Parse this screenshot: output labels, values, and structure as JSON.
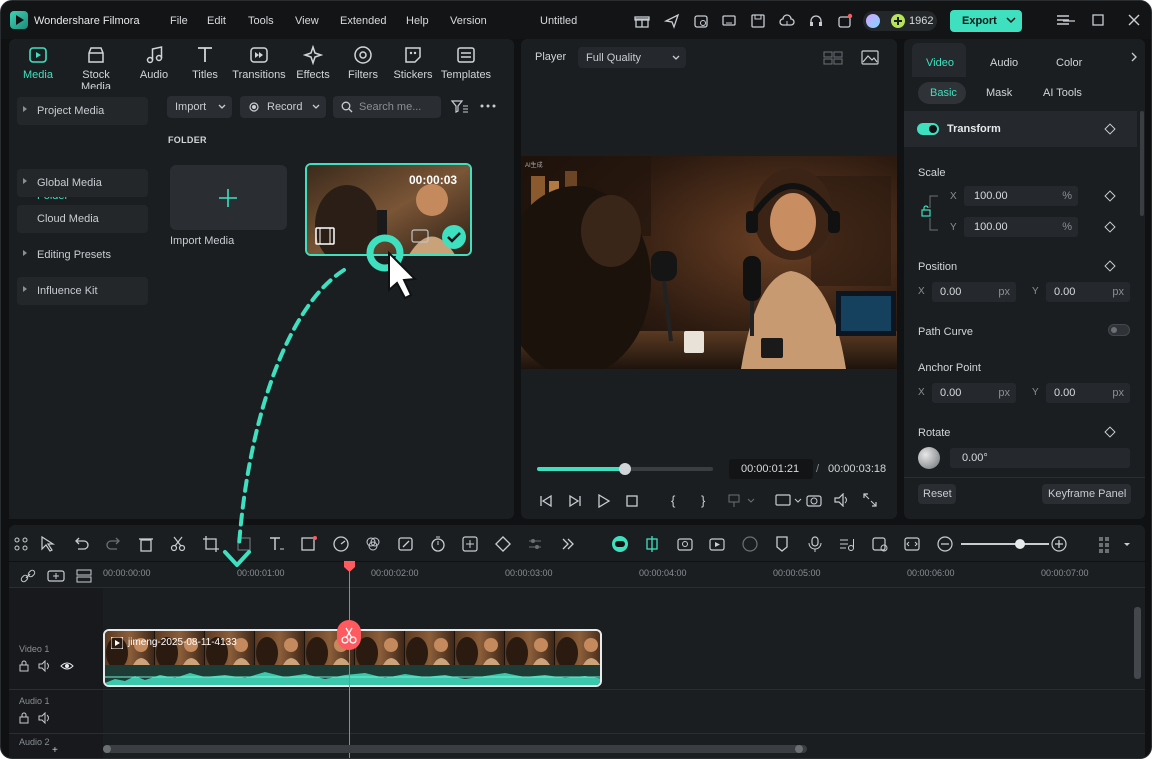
{
  "app": {
    "name": "Wondershare Filmora",
    "doc_title": "Untitled",
    "credits": "1962",
    "export_label": "Export"
  },
  "menu": [
    "File",
    "Edit",
    "Tools",
    "View",
    "Extended",
    "Help",
    "Version"
  ],
  "media_tabs": [
    {
      "label": "Media",
      "icon": "media-icon",
      "active": true
    },
    {
      "label": "Stock Media",
      "icon": "stock-media-icon"
    },
    {
      "label": "Audio",
      "icon": "music-note-icon"
    },
    {
      "label": "Titles",
      "icon": "text-t-icon"
    },
    {
      "label": "Transitions",
      "icon": "transitions-icon"
    },
    {
      "label": "Effects",
      "icon": "sparkle-icon"
    },
    {
      "label": "Filters",
      "icon": "filter-icon"
    },
    {
      "label": "Stickers",
      "icon": "sticker-icon"
    },
    {
      "label": "Templates",
      "icon": "templates-icon"
    }
  ],
  "sidebar": [
    {
      "label": "Project Media",
      "arrow": true,
      "bg": true
    },
    {
      "label": "Folder",
      "active": true
    },
    {
      "label": "Global Media",
      "arrow": true,
      "bg": true
    },
    {
      "label": "Cloud Media",
      "bg": true
    },
    {
      "label": "Editing Presets",
      "arrow": true
    },
    {
      "label": "Influence Kit",
      "arrow": true,
      "bg": true
    }
  ],
  "toolbar": {
    "import_label": "Import",
    "record_label": "Record",
    "search_placeholder": "Search me..."
  },
  "media_area": {
    "section_label": "FOLDER",
    "import_media_label": "Import Media",
    "clip_duration": "00:00:03"
  },
  "player": {
    "label": "Player",
    "quality": "Full Quality",
    "current_time": "00:00:01:21",
    "separator": "/",
    "total_time": "00:00:03:18",
    "progress": 0.5,
    "watermark": "AI生成"
  },
  "properties": {
    "tabs": [
      "Video",
      "Audio",
      "Color"
    ],
    "subtabs": [
      "Basic",
      "Mask",
      "AI Tools"
    ],
    "transform_label": "Transform",
    "scale_label": "Scale",
    "scale_x": "100.00",
    "scale_y": "100.00",
    "percent_unit": "%",
    "position_label": "Position",
    "pos_x": "0.00",
    "pos_y": "0.00",
    "px_unit": "px",
    "path_curve_label": "Path Curve",
    "anchor_label": "Anchor Point",
    "anchor_x": "0.00",
    "anchor_y": "0.00",
    "rotate_label": "Rotate",
    "rotate_value": "0.00°",
    "x_label": "X",
    "y_label": "Y",
    "reset_label": "Reset",
    "keyframe_label": "Keyframe Panel"
  },
  "timeline": {
    "ruler": [
      "00:00:00:00",
      "00:00:01:00",
      "00:00:02:00",
      "00:00:03:00",
      "00:00:04:00",
      "00:00:05:00",
      "00:00:06:00",
      "00:00:07:00"
    ],
    "tracks": [
      "Video 1",
      "Audio 1",
      "Audio 2"
    ],
    "clip_name": "jimeng-2025-08-11-4133"
  },
  "colors": {
    "accent": "#3fe0bf",
    "playhead": "#ff5a5f",
    "panel": "#1b1e21",
    "background": "#0f1113"
  }
}
